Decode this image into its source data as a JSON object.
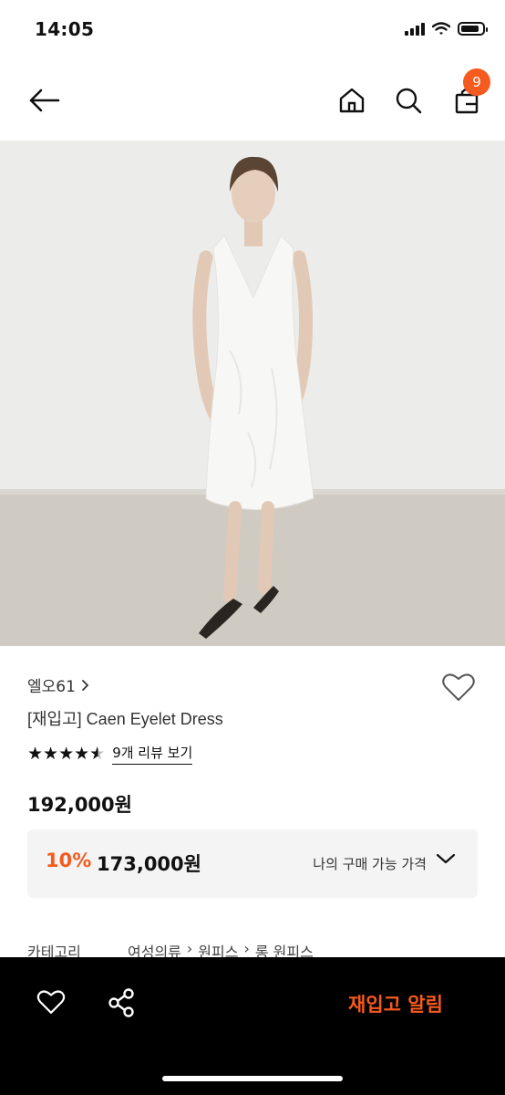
{
  "status_bar": {
    "time": "14:05"
  },
  "header": {
    "cart_count": "9"
  },
  "product": {
    "brand": "엘오61",
    "title": "[재입고] Caen Eyelet Dress",
    "rating": 4.5,
    "rating_max": 5,
    "review_link": "9개 리뷰 보기",
    "price": "192,000원"
  },
  "offer": {
    "discount": "10%",
    "sale_price": "173,000원",
    "label": "나의 구매 가능 가격"
  },
  "category": {
    "label": "카테고리",
    "path": [
      "여성의류",
      "원피스",
      "롱 원피스"
    ]
  },
  "bottom_bar": {
    "restock_label": "재입고 알림"
  },
  "colors": {
    "accent": "#f55a1e",
    "bar_bg": "#000000"
  }
}
